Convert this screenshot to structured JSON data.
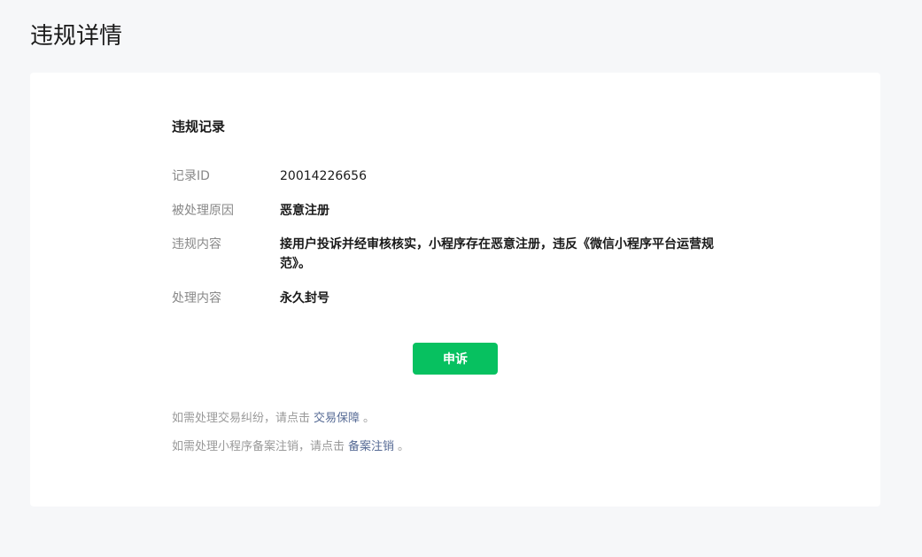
{
  "page": {
    "title": "违规详情"
  },
  "record": {
    "section_title": "违规记录",
    "fields": [
      {
        "label": "记录ID",
        "value": "20014226656"
      },
      {
        "label": "被处理原因",
        "value": "恶意注册"
      },
      {
        "label": "违规内容",
        "value": "接用户投诉并经审核核实，小程序存在恶意注册，违反《微信小程序平台运营规范》。"
      },
      {
        "label": "处理内容",
        "value": "永久封号"
      }
    ]
  },
  "actions": {
    "appeal_label": "申诉"
  },
  "notes": [
    {
      "prefix": "如需处理交易纠纷，请点击",
      "link": "交易保障",
      "suffix": "。"
    },
    {
      "prefix": "如需处理小程序备案注销，请点击",
      "link": "备案注销",
      "suffix": "。"
    }
  ],
  "colors": {
    "accent": "#07c160",
    "link": "#576b95",
    "background": "#f6f7f9"
  }
}
